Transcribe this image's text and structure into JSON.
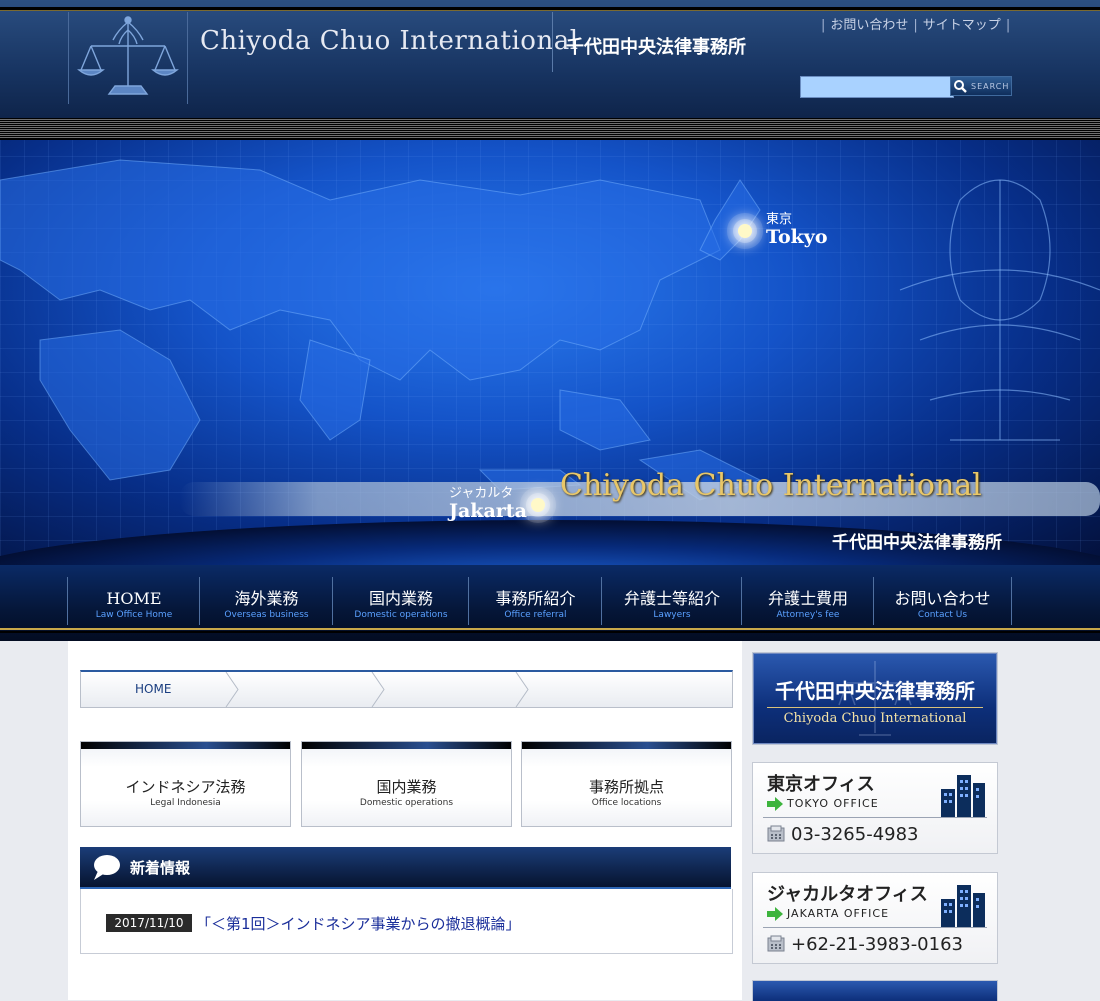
{
  "header": {
    "logo_en": "Chiyoda Chuo International",
    "logo_jp": "千代田中央法律事務所",
    "links": [
      "お問い合わせ",
      "サイトマップ"
    ],
    "search_placeholder": "",
    "search_label": "SEARCH"
  },
  "hero": {
    "brand_en": "Chiyoda Chuo International",
    "brand_jp": "千代田中央法律事務所",
    "tokyo_jp": "東京",
    "tokyo_en": "Tokyo",
    "jakarta_jp": "ジャカルタ",
    "jakarta_en": "Jakarta"
  },
  "nav": [
    {
      "jp": "HOME",
      "en": "Law Office Home"
    },
    {
      "jp": "海外業務",
      "en": "Overseas business"
    },
    {
      "jp": "国内業務",
      "en": "Domestic operations"
    },
    {
      "jp": "事務所紹介",
      "en": "Office referral"
    },
    {
      "jp": "弁護士等紹介",
      "en": "Lawyers"
    },
    {
      "jp": "弁護士費用",
      "en": "Attorney's fee"
    },
    {
      "jp": "お問い合わせ",
      "en": "Contact Us"
    }
  ],
  "breadcrumb": [
    "HOME"
  ],
  "tiles": [
    {
      "jp": "インドネシア法務",
      "en": "Legal Indonesia"
    },
    {
      "jp": "国内業務",
      "en": "Domestic operations"
    },
    {
      "jp": "事務所拠点",
      "en": "Office locations"
    }
  ],
  "news": {
    "title": "新着情報",
    "items": [
      {
        "date": "2017/11/10",
        "text": "「＜第1回＞インドネシア事業からの撤退概論」"
      }
    ]
  },
  "sidebar": {
    "banner_jp": "千代田中央法律事務所",
    "banner_en": "Chiyoda Chuo International",
    "offices": [
      {
        "name": "東京オフィス",
        "sub": "TOKYO OFFICE",
        "tel": "03-3265-4983"
      },
      {
        "name": "ジャカルタオフィス",
        "sub": "JAKARTA OFFICE",
        "tel": "+62-21-3983-0163"
      }
    ]
  },
  "colors": {
    "header_navy": "#16325f",
    "gold": "#c9a84a",
    "link_blue": "#1a2e9a",
    "nav_sub_blue": "#5aa0ff"
  }
}
